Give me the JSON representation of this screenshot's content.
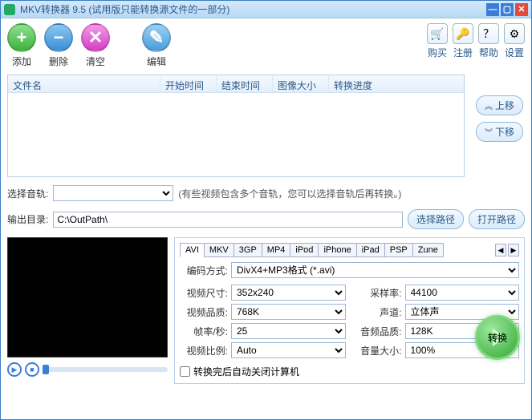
{
  "title": "MKV转换器 9.5 (试用版只能转换源文件的一部分)",
  "toolbar": {
    "add": "添加",
    "remove": "删除",
    "clear": "清空",
    "edit": "编辑",
    "buy": "购买",
    "register": "注册",
    "help": "帮助",
    "settings": "设置"
  },
  "list_headers": {
    "filename": "文件名",
    "start": "开始时间",
    "end": "结束时间",
    "imgsize": "图像大小",
    "progress": "转换进度"
  },
  "side": {
    "up": "上移",
    "down": "下移"
  },
  "track": {
    "label": "选择音轨:",
    "hint": "(有些视频包含多个音轨，您可以选择音轨后再转换。)"
  },
  "output": {
    "label": "输出目录:",
    "value": "C:\\OutPath\\",
    "browse": "选择路径",
    "open": "打开路径"
  },
  "tabs": [
    "AVI",
    "MKV",
    "3GP",
    "MP4",
    "iPod",
    "iPhone",
    "iPad",
    "PSP",
    "Zune"
  ],
  "fields": {
    "enc_label": "编码方式:",
    "enc_value": "DivX4+MP3格式 (*.avi)",
    "size_label": "视频尺寸:",
    "size_value": "352x240",
    "rate_label": "采样率:",
    "rate_value": "44100",
    "vq_label": "视频品质:",
    "vq_value": "768K",
    "ch_label": "声道:",
    "ch_value": "立体声",
    "fps_label": "帧率/秒:",
    "fps_value": "25",
    "aq_label": "音频品质:",
    "aq_value": "128K",
    "ratio_label": "视频比例:",
    "ratio_value": "Auto",
    "vol_label": "音量大小:",
    "vol_value": "100%"
  },
  "shutdown": "转换完后自动关闭计算机",
  "convert": "转换"
}
